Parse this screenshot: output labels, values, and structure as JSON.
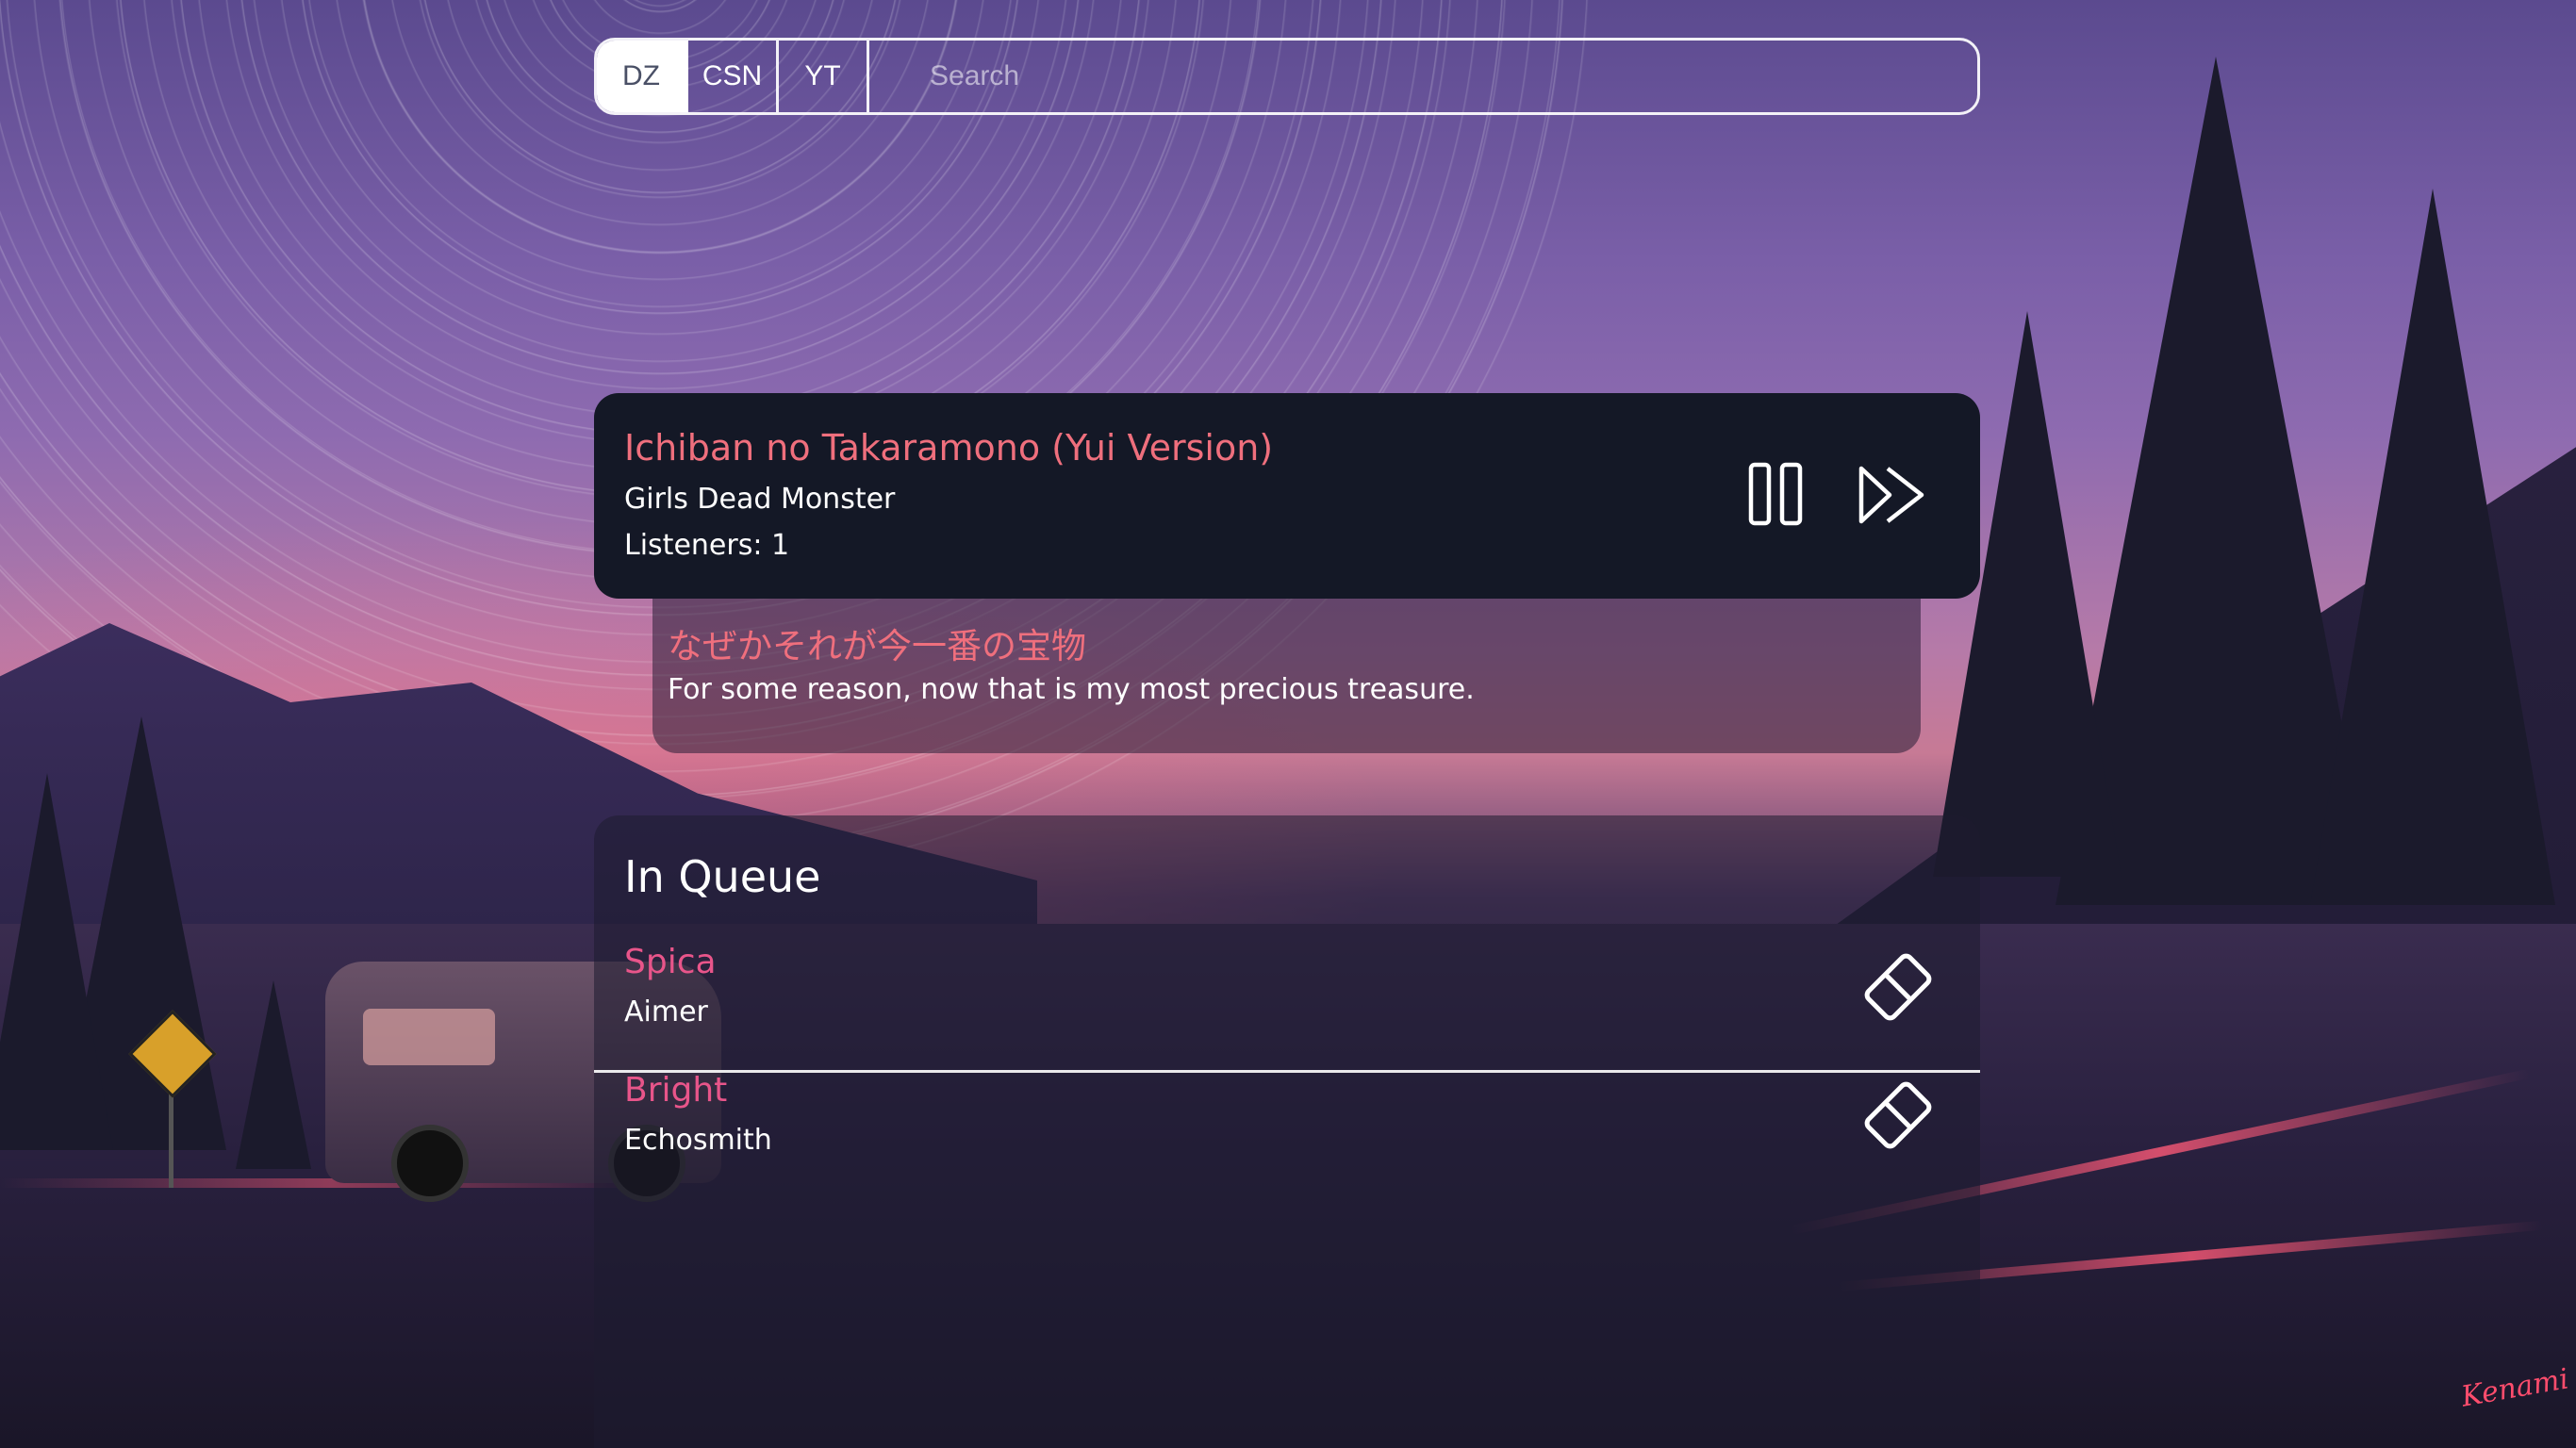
{
  "search": {
    "sources": [
      {
        "label": "DZ",
        "active": true
      },
      {
        "label": "CSN",
        "active": false
      },
      {
        "label": "YT",
        "active": false
      }
    ],
    "placeholder": "Search",
    "value": ""
  },
  "now_playing": {
    "title": "Ichiban no Takaramono (Yui Version)",
    "artist": "Girls Dead Monster",
    "listeners": "Listeners: 1",
    "pause_icon": "pause-icon",
    "skip_icon": "skip-forward-icon"
  },
  "lyrics": {
    "original": "なぜかそれが今一番の宝物",
    "translation": "For some reason, now that is my most precious treasure."
  },
  "queue": {
    "heading": "In Queue",
    "items": [
      {
        "title": "Spica",
        "artist": "Aimer",
        "remove_icon": "eraser-icon"
      },
      {
        "title": "Bright",
        "artist": "Echosmith",
        "remove_icon": "eraser-icon"
      }
    ]
  },
  "background": {
    "signature": "Kenami"
  },
  "colors": {
    "accent_title": "#ef6f7d",
    "accent_queue": "#e8558a",
    "panel": "#141826"
  }
}
